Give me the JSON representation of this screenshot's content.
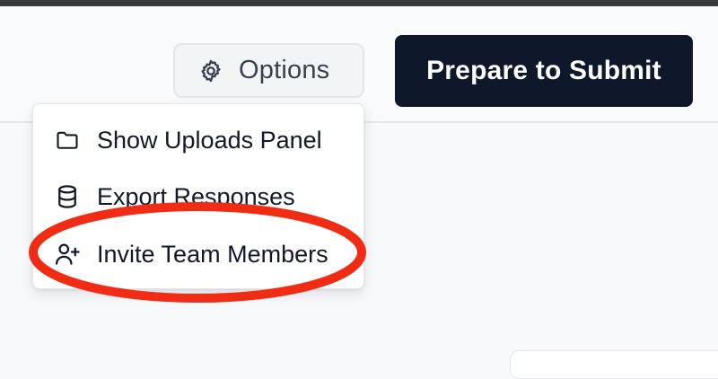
{
  "toolbar": {
    "options_label": "Options",
    "options_icon": "gear-icon",
    "submit_label": "Prepare to Submit"
  },
  "menu": {
    "items": [
      {
        "label": "Show Uploads Panel",
        "icon": "folder-icon"
      },
      {
        "label": "Export Responses",
        "icon": "database-icon"
      },
      {
        "label": "Invite Team Members",
        "icon": "user-plus-icon"
      }
    ]
  },
  "colors": {
    "primary_button": "#0f172a",
    "annotation": "#f12c15",
    "text": "#111827",
    "muted_text": "#374151"
  }
}
